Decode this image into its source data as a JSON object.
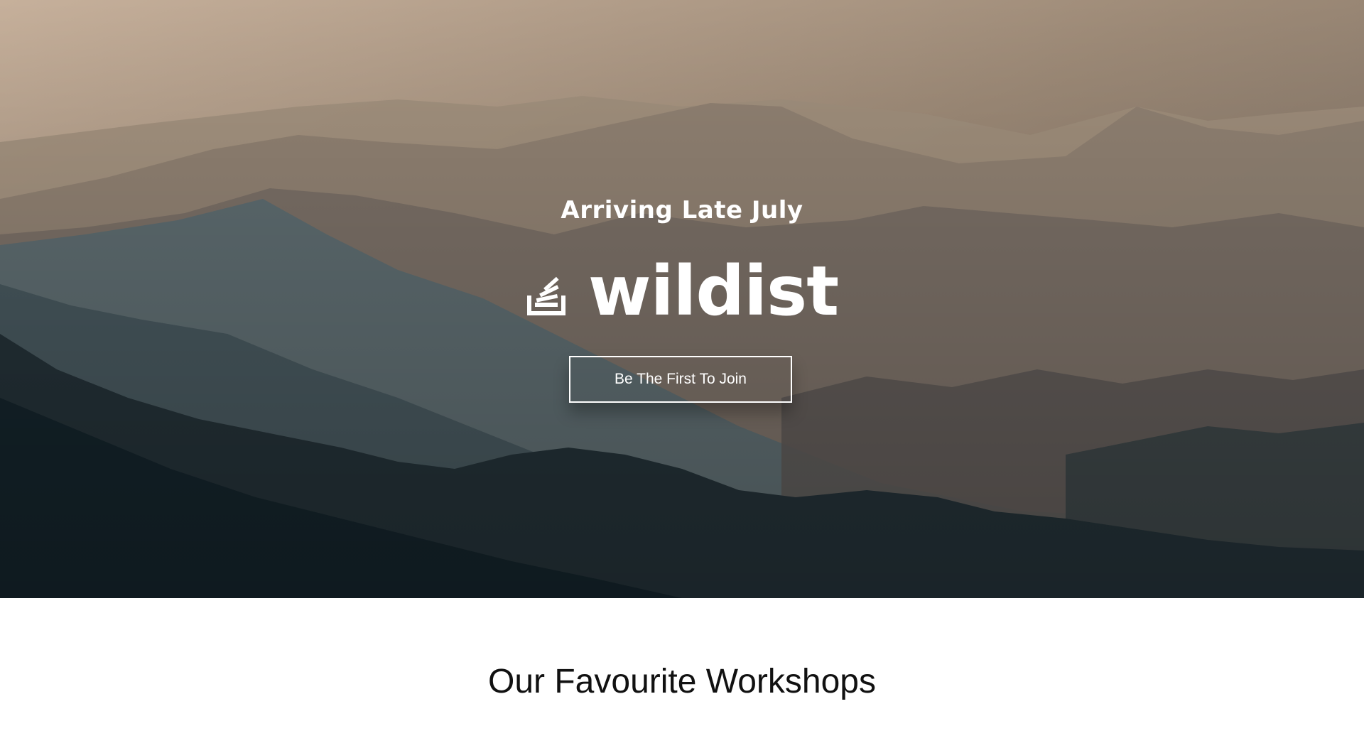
{
  "hero": {
    "tagline": "Arriving Late July",
    "brand_icon": "stacked-layers-logo-icon",
    "brand_name": "wildist",
    "cta_label": "Be The First To Join",
    "background": "misty-mountain-ranges-photo"
  },
  "section": {
    "title": "Our Favourite Workshops"
  },
  "colors": {
    "sky_top": "#c9b39e",
    "sky_mid": "#8c7b6c",
    "ridge_dark": "#0f1f26",
    "text_light": "#ffffff",
    "text_dark": "#111111",
    "page_bg": "#ffffff"
  }
}
